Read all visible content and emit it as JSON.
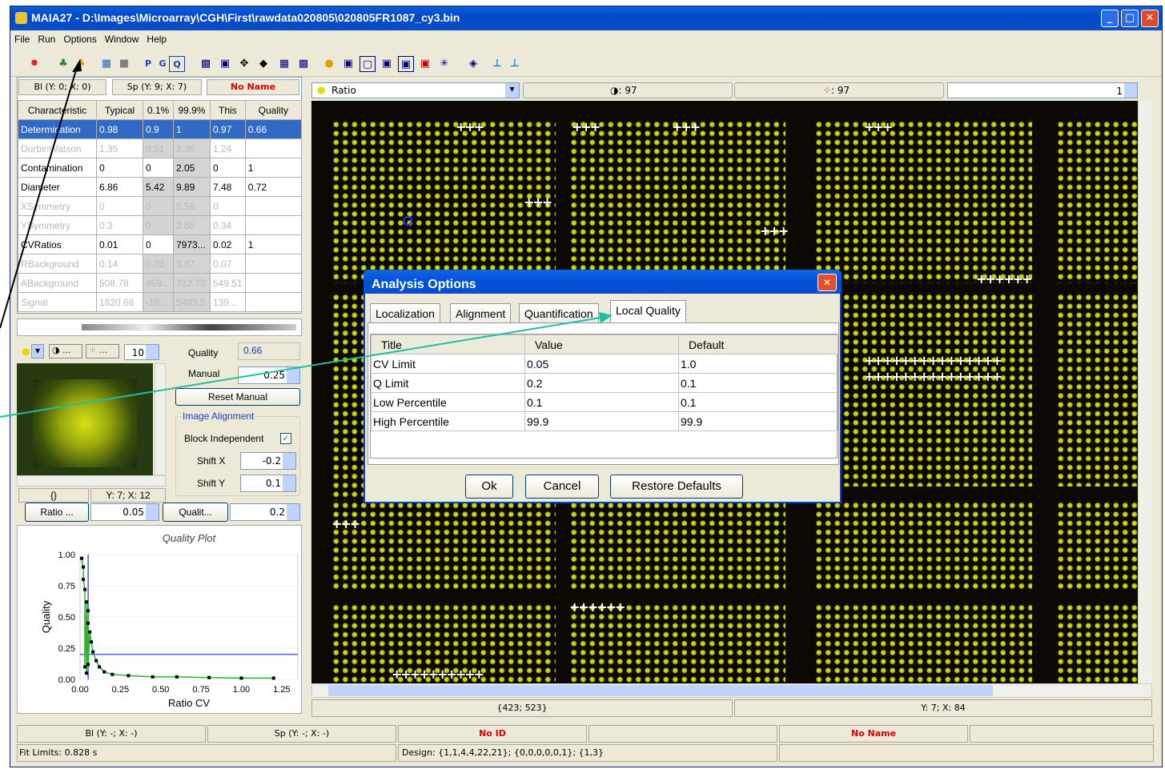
{
  "window": {
    "title": "MAIA27 - D:\\Images\\Microarray\\CGH\\First\\rawdata020805\\020805FR1087_cy3.bin"
  },
  "menu": [
    "File",
    "Run",
    "Options",
    "Window",
    "Help"
  ],
  "toolbar": {
    "p": "P",
    "g": "G",
    "q": "Q"
  },
  "left_header": {
    "bl": "Bl (Y: 0; X: 0)",
    "sp": "Sp (Y: 9; X: 7)",
    "name": "No Name"
  },
  "quality_table": {
    "columns": [
      "Characteristic",
      "Typical",
      "0.1%",
      "99.9%",
      "This",
      "Quality"
    ],
    "rows": [
      [
        "Determination",
        "0.98",
        "0.9",
        "1",
        "0.97",
        "0.66"
      ],
      [
        "DurbinWatson",
        "1.35",
        "0.51",
        "2.36",
        "1.24",
        ""
      ],
      [
        "Contamination",
        "0",
        "0",
        "2.05",
        "0",
        "1"
      ],
      [
        "Diameter",
        "6.86",
        "5.42",
        "9.89",
        "7.48",
        "0.72"
      ],
      [
        "XSymmetry",
        "0",
        "0",
        "5.58",
        "0",
        ""
      ],
      [
        "YSymmetry",
        "0.3",
        "0",
        "2.65",
        "0.34",
        ""
      ],
      [
        "CVRatios",
        "0.01",
        "0",
        "7973...",
        "0.02",
        "1"
      ],
      [
        "RBackground",
        "0.14",
        "0.03",
        "3.87",
        "0.07",
        ""
      ],
      [
        "ABackground",
        "508.78",
        "459...",
        "712.73",
        "549.51",
        ""
      ],
      [
        "Signal",
        "1820.68",
        "-10...",
        "5483.5",
        "139...",
        ""
      ]
    ]
  },
  "spot_panel": {
    "zoom_value": "10",
    "quality_label": "Quality",
    "quality_value": "0.66",
    "manual_label": "Manual",
    "manual_value": "0.25",
    "reset_manual": "Reset Manual",
    "image_alignment": "Image Alignment",
    "block_independent": "Block Independent",
    "shift_x_label": "Shift X",
    "shift_x_value": "-0.2",
    "shift_y_label": "Shift Y",
    "shift_y_value": "0.1",
    "coord_left": "{}",
    "coord_right": "Y: 7; X: 12"
  },
  "plot_controls": {
    "ratio_btn": "Ratio ...",
    "ratio_value": "0.05",
    "qualit_btn": "Qualit...",
    "qualit_value": "0.2"
  },
  "chart_data": {
    "type": "scatter",
    "title": "Quality Plot",
    "xlabel": "Ratio CV",
    "ylabel": "Quality",
    "xlim": [
      0,
      1.35
    ],
    "ylim": [
      0,
      1.0
    ],
    "xticks": [
      "0.00",
      "0.25",
      "0.50",
      "0.75",
      "1.00",
      "1.25"
    ],
    "yticks": [
      "0.00",
      "0.25",
      "0.50",
      "0.75",
      "1.00"
    ],
    "threshold_x": 0.05,
    "threshold_y": 0.2,
    "series": [
      {
        "points": [
          [
            0.01,
            0.97
          ],
          [
            0.02,
            0.9
          ],
          [
            0.02,
            0.8
          ],
          [
            0.03,
            0.72
          ],
          [
            0.04,
            0.62
          ],
          [
            0.05,
            0.55
          ],
          [
            0.05,
            0.45
          ],
          [
            0.06,
            0.38
          ],
          [
            0.07,
            0.3
          ],
          [
            0.08,
            0.22
          ],
          [
            0.1,
            0.15
          ],
          [
            0.12,
            0.1
          ],
          [
            0.15,
            0.06
          ],
          [
            0.2,
            0.04
          ],
          [
            0.3,
            0.03
          ],
          [
            0.45,
            0.02
          ],
          [
            0.6,
            0.02
          ],
          [
            0.8,
            0.015
          ],
          [
            1.0,
            0.01
          ],
          [
            1.2,
            0.01
          ],
          [
            0.04,
            0.05
          ],
          [
            0.03,
            0.1
          ],
          [
            0.05,
            0.12
          ]
        ]
      }
    ]
  },
  "image_header": {
    "mode": "Ratio",
    "count1": ": 97",
    "count2": ": 97",
    "spin": "1"
  },
  "image_footer": {
    "left": "{423; 523}",
    "right": "Y: 7; X: 84"
  },
  "dialog": {
    "title": "Analysis Options",
    "tabs": [
      "Localization",
      "Alignment",
      "Quantification",
      "Local Quality"
    ],
    "columns": [
      "Title",
      "Value",
      "Default"
    ],
    "rows": [
      [
        "CV Limit",
        "0.05",
        "1.0"
      ],
      [
        "Q Limit",
        "0.2",
        "0.1"
      ],
      [
        "Low Percentile",
        "0.1",
        "0.1"
      ],
      [
        "High Percentile",
        "99.9",
        "99.9"
      ]
    ],
    "ok": "Ok",
    "cancel": "Cancel",
    "restore": "Restore Defaults"
  },
  "statusbar": {
    "bl": "Bl (Y: -; X: -)",
    "sp": "Sp (Y: -; X: -)",
    "noid": "No ID",
    "noname": "No Name",
    "fit": "Fit Limits: 0.828 s",
    "design": "Design: {1,1,4,4,22,21}; {0,0,0,0,0,1}; {1,3}"
  },
  "colors": {
    "accent": "#316ac5",
    "arrow_black": "#000000",
    "arrow_teal": "#1fbfa0",
    "spot": "#d8e414"
  }
}
